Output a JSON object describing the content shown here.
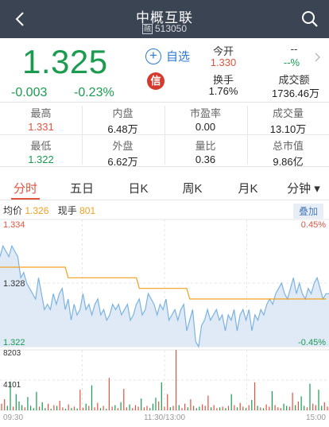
{
  "header": {
    "title": "中概互联",
    "tag": "融",
    "code": "513050",
    "colors": {
      "bg": "#3b4452"
    }
  },
  "quote": {
    "price": "1.325",
    "change": "-0.003",
    "change_pct": "-0.23%",
    "add_watch": "自选",
    "open_label": "今开",
    "open_value": "1.330",
    "right_top_value": "--",
    "right_top_pct": "--%",
    "turnover_label": "换手",
    "turnover_value": "1.76%",
    "amount_label": "成交额",
    "amount_value": "1736.46万",
    "credit_icon": "信",
    "colors": {
      "up": "#e0533f",
      "down": "#1a9b50"
    }
  },
  "stats": [
    {
      "label": "最高",
      "value": "1.331",
      "color": "#e0533f"
    },
    {
      "label": "内盘",
      "value": "6.48万",
      "color": "#222"
    },
    {
      "label": "市盈率",
      "value": "0.00",
      "color": "#222"
    },
    {
      "label": "成交量",
      "value": "13.10万",
      "color": "#222"
    },
    {
      "label": "最低",
      "value": "1.322",
      "color": "#1a9b50"
    },
    {
      "label": "外盘",
      "value": "6.62万",
      "color": "#222"
    },
    {
      "label": "量比",
      "value": "0.36",
      "color": "#222"
    },
    {
      "label": "总市值",
      "value": "9.86亿",
      "color": "#222"
    }
  ],
  "tabs": [
    "分时",
    "五日",
    "日K",
    "周K",
    "月K",
    "分钟 ▾"
  ],
  "legend": {
    "avg_label": "均价",
    "avg_value": "1.326",
    "now_label": "现手",
    "now_value": "801",
    "overlay_btn": "叠加"
  },
  "chart_data": {
    "type": "line",
    "price_axis": {
      "top": "1.334",
      "mid": "1.328",
      "bottom": "1.322",
      "top_pct": "0.45%",
      "bottom_pct": "-0.45%",
      "ylim": [
        1.322,
        1.334
      ]
    },
    "volume_axis": {
      "top": "8203",
      "mid": "4101"
    },
    "time_labels": [
      "09:30",
      "11:30/13:00",
      "15:00"
    ],
    "series": [
      {
        "name": "价格",
        "color": "#7bb3e0",
        "values": [
          1.3305,
          1.3315,
          1.331,
          1.3305,
          1.3315,
          1.331,
          1.3305,
          1.3285,
          1.329,
          1.328,
          1.3275,
          1.327,
          1.3265,
          1.3285,
          1.327,
          1.3255,
          1.326,
          1.3255,
          1.327,
          1.326,
          1.327,
          1.3275,
          1.3255,
          1.3265,
          1.3245,
          1.326,
          1.325,
          1.3255,
          1.327,
          1.3255,
          1.326,
          1.325,
          1.326,
          1.3265,
          1.325,
          1.3255,
          1.3245,
          1.325,
          1.326,
          1.3255,
          1.326,
          1.325,
          1.3255,
          1.326,
          1.3245,
          1.325,
          1.326,
          1.3265,
          1.325,
          1.3255,
          1.327,
          1.3265,
          1.326,
          1.325,
          1.326,
          1.3255,
          1.3265,
          1.3245,
          1.325,
          1.3255,
          1.3245,
          1.3255,
          1.326,
          1.3235,
          1.3245,
          1.3255,
          1.3225,
          1.322,
          1.324,
          1.3245,
          1.3255,
          1.3245,
          1.325,
          1.3255,
          1.3245,
          1.325,
          1.3235,
          1.325,
          1.3245,
          1.3255,
          1.3235,
          1.325,
          1.3255,
          1.3245,
          1.3255,
          1.3235,
          1.325,
          1.3245,
          1.3255,
          1.325,
          1.326,
          1.3265,
          1.326,
          1.327,
          1.3275,
          1.328,
          1.327,
          1.3265,
          1.3275,
          1.3285,
          1.327,
          1.328,
          1.327,
          1.3265,
          1.3275,
          1.327,
          1.328,
          1.3285,
          1.3275,
          1.3265,
          1.327,
          1.327
        ]
      },
      {
        "name": "均价",
        "color": "#f0a020",
        "values": [
          1.3295,
          1.3295,
          1.3295,
          1.3295,
          1.3295,
          1.3295,
          1.3295,
          1.3295,
          1.3295,
          1.3295,
          1.3295,
          1.3295,
          1.3295,
          1.3295,
          1.3295,
          1.3295,
          1.3295,
          1.3295,
          1.3295,
          1.3295,
          1.3295,
          1.3295,
          1.3295,
          1.3285,
          1.3285,
          1.3285,
          1.3285,
          1.3285,
          1.3285,
          1.3285,
          1.3285,
          1.3285,
          1.3285,
          1.3285,
          1.3285,
          1.3285,
          1.3285,
          1.3285,
          1.3285,
          1.3285,
          1.3285,
          1.3285,
          1.3285,
          1.3285,
          1.3285,
          1.3285,
          1.3285,
          1.3275,
          1.3275,
          1.3275,
          1.3275,
          1.3275,
          1.3275,
          1.3275,
          1.3275,
          1.3275,
          1.3275,
          1.3275,
          1.3275,
          1.3275,
          1.3275,
          1.3275,
          1.3275,
          1.3275,
          1.3265,
          1.3265,
          1.3265,
          1.3265,
          1.3265,
          1.3265,
          1.3265,
          1.3265,
          1.3265,
          1.3265,
          1.3265,
          1.3265,
          1.3265,
          1.3265,
          1.3265,
          1.3265,
          1.3265,
          1.3265,
          1.3265,
          1.3265,
          1.3265,
          1.3265,
          1.3265,
          1.3265,
          1.3265,
          1.3265,
          1.3265,
          1.3265,
          1.3265,
          1.3265,
          1.3265,
          1.3265,
          1.3265,
          1.3265,
          1.3265,
          1.3265,
          1.3265,
          1.3265,
          1.3265,
          1.3265,
          1.3265,
          1.3265,
          1.3265,
          1.3265,
          1.3265,
          1.3265,
          1.3265
        ]
      }
    ],
    "volume": [
      900,
      1500,
      600,
      3900,
      500,
      2200,
      1200,
      700,
      400,
      1800,
      600,
      300,
      2500,
      500,
      1100,
      300,
      900,
      200,
      700,
      600,
      1300,
      400,
      200,
      800,
      300,
      500,
      250,
      2800,
      350,
      900,
      600,
      3400,
      400,
      1000,
      300,
      600,
      200,
      4400,
      500,
      700,
      300,
      1100,
      2900,
      400,
      800,
      300,
      700,
      500,
      1600,
      400,
      600,
      300,
      900,
      1700,
      1200,
      3800,
      500,
      2200,
      400,
      600,
      8203,
      700,
      300,
      900,
      400,
      1500,
      600,
      300,
      500,
      800,
      600,
      2000,
      400,
      700,
      300,
      400,
      500,
      300,
      600,
      2200,
      700,
      400,
      1000,
      500,
      300,
      700,
      1400,
      3800,
      600,
      400,
      300,
      800,
      500,
      2600,
      700,
      400,
      300,
      900,
      600,
      500,
      2400,
      700,
      1200,
      1900,
      600,
      400,
      3600,
      900,
      700,
      2800,
      600,
      1100,
      500
    ],
    "volume_colors": "price_change"
  }
}
